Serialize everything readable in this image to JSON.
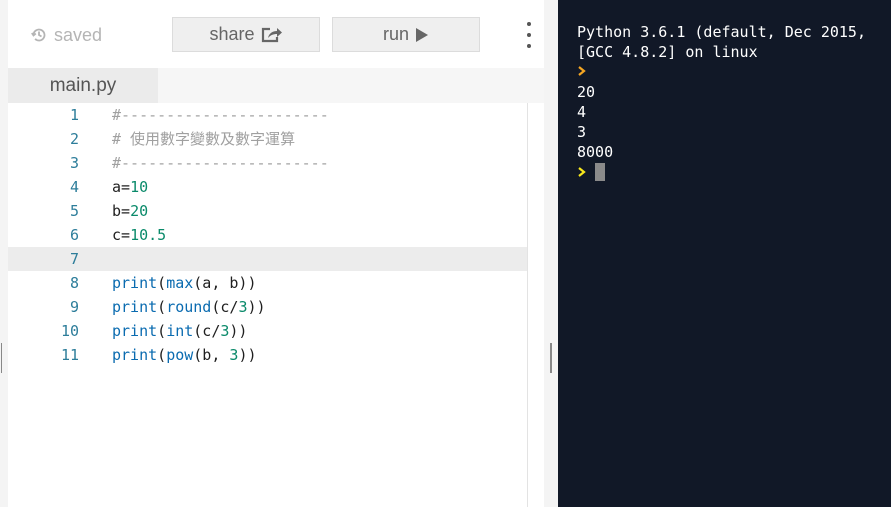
{
  "toolbar": {
    "saved_label": "saved",
    "share_label": "share",
    "run_label": "run"
  },
  "tabs": [
    {
      "label": "main.py"
    }
  ],
  "editor": {
    "lines": [
      {
        "num": "1",
        "text": "#-----------------------"
      },
      {
        "num": "2",
        "text": "# 使用數字變數及數字運算"
      },
      {
        "num": "3",
        "text": "#-----------------------"
      },
      {
        "num": "4",
        "text": "a=10"
      },
      {
        "num": "5",
        "text": "b=20"
      },
      {
        "num": "6",
        "text": "c=10.5"
      },
      {
        "num": "7",
        "text": ""
      },
      {
        "num": "8",
        "text": "print(max(a, b))"
      },
      {
        "num": "9",
        "text": "print(round(c/3))"
      },
      {
        "num": "10",
        "text": "print(int(c/3))"
      },
      {
        "num": "11",
        "text": "print(pow(b, 3))"
      }
    ]
  },
  "console": {
    "header_line1": "Python 3.6.1 (default, Dec 2015,",
    "header_line2": "[GCC 4.8.2] on linux",
    "outputs": [
      "20",
      "4",
      "3",
      "8000"
    ]
  },
  "colors": {
    "console_bg": "#111827",
    "prompt_orange": "#f5a623",
    "prompt_yellow": "#f8e71c",
    "line_number": "#2d7d9a",
    "builtin": "#0a6bb0",
    "number": "#0a8a6a",
    "comment": "#a0a0a0"
  }
}
